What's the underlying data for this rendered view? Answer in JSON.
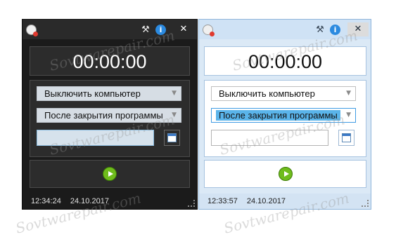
{
  "watermark_text": "Sovtwarepair.com",
  "colors": {
    "dark_window_bg": "#1b1b1b",
    "dark_panel_bg": "#2c2c2c",
    "light_window_bg": "#dbe9f6",
    "accent_blue": "#2b8ae0",
    "play_green": "#6fbc1c",
    "selection_blue": "#5ab4ea"
  },
  "dark_window": {
    "title_icons": [
      "app-icon",
      "tools-icon",
      "info-icon",
      "close-icon"
    ],
    "close_glyph": "✕",
    "tools_glyph": "⚒",
    "info_glyph": "i",
    "timer": "00:00:00",
    "action_select": "Выключить компьютер",
    "condition_select": "После закрытия программы",
    "time_input_value": "",
    "status_time": "12:34:24",
    "status_date": "24.10.2017"
  },
  "light_window": {
    "title_icons": [
      "app-icon",
      "tools-icon",
      "info-icon",
      "close-icon"
    ],
    "close_glyph": "✕",
    "tools_glyph": "⚒",
    "info_glyph": "i",
    "timer": "00:00:00",
    "action_select": "Выключить компьютер",
    "condition_select": "После закрытия программы",
    "time_input_value": "",
    "status_time": "12:33:57",
    "status_date": "24.10.2017"
  }
}
